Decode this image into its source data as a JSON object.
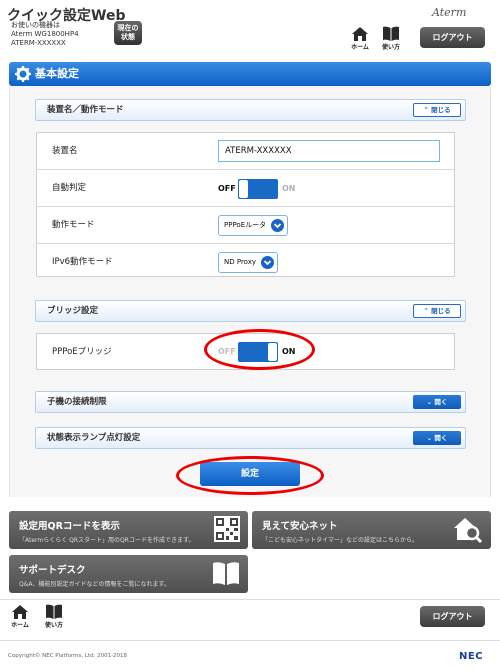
{
  "header": {
    "app_title": "クイック設定Web",
    "device_line1": "お使いの機器は",
    "device_line2": "Aterm WG1800HP4",
    "device_line3": "ATERM-XXXXXX",
    "status_button_line1": "現在の",
    "status_button_line2": "状態",
    "brand": "Aterm",
    "home_label": "ホーム",
    "help_label": "使い方",
    "logout_label": "ログアウト"
  },
  "page_title": "基本設定",
  "sections": {
    "device": {
      "title": "装置名／動作モード",
      "toggle_label": "閉じる",
      "rows": {
        "name_label": "装置名",
        "name_value": "ATERM-XXXXXX",
        "auto_label": "自動判定",
        "auto_off": "OFF",
        "auto_on": "ON",
        "mode_label": "動作モード",
        "mode_value": "PPPoEルータ",
        "ipv6_label": "IPv6動作モード",
        "ipv6_value": "ND Proxy"
      }
    },
    "bridge": {
      "title": "ブリッジ設定",
      "toggle_label": "閉じる",
      "pppoe_label": "PPPoEブリッジ",
      "pppoe_off": "OFF",
      "pppoe_on": "ON"
    },
    "child": {
      "title": "子機の接続制限",
      "toggle_label": "開く"
    },
    "lamp": {
      "title": "状態表示ランプ点灯設定",
      "toggle_label": "開く"
    }
  },
  "save_label": "設定",
  "tiles": {
    "qr": {
      "title": "設定用QRコードを表示",
      "desc": "「Atermらくらく QRスタート」用のQRコードを作成できます。"
    },
    "security": {
      "title": "見えて安心ネット",
      "desc": "「こども安心ネットタイマー」などの設定はこちらから。"
    },
    "support": {
      "title": "サポートデスク",
      "desc": "Q&A、機能別設定ガイドなどの情報をご覧になれます。"
    }
  },
  "footer": {
    "home_label": "ホーム",
    "help_label": "使い方",
    "logout_label": "ログアウト",
    "copyright": "Copyright© NEC Platforms, Ltd. 2001-2018",
    "nec_logo": "NEC"
  },
  "colors": {
    "accent": "#1464c4",
    "annotation": "#e00000"
  }
}
